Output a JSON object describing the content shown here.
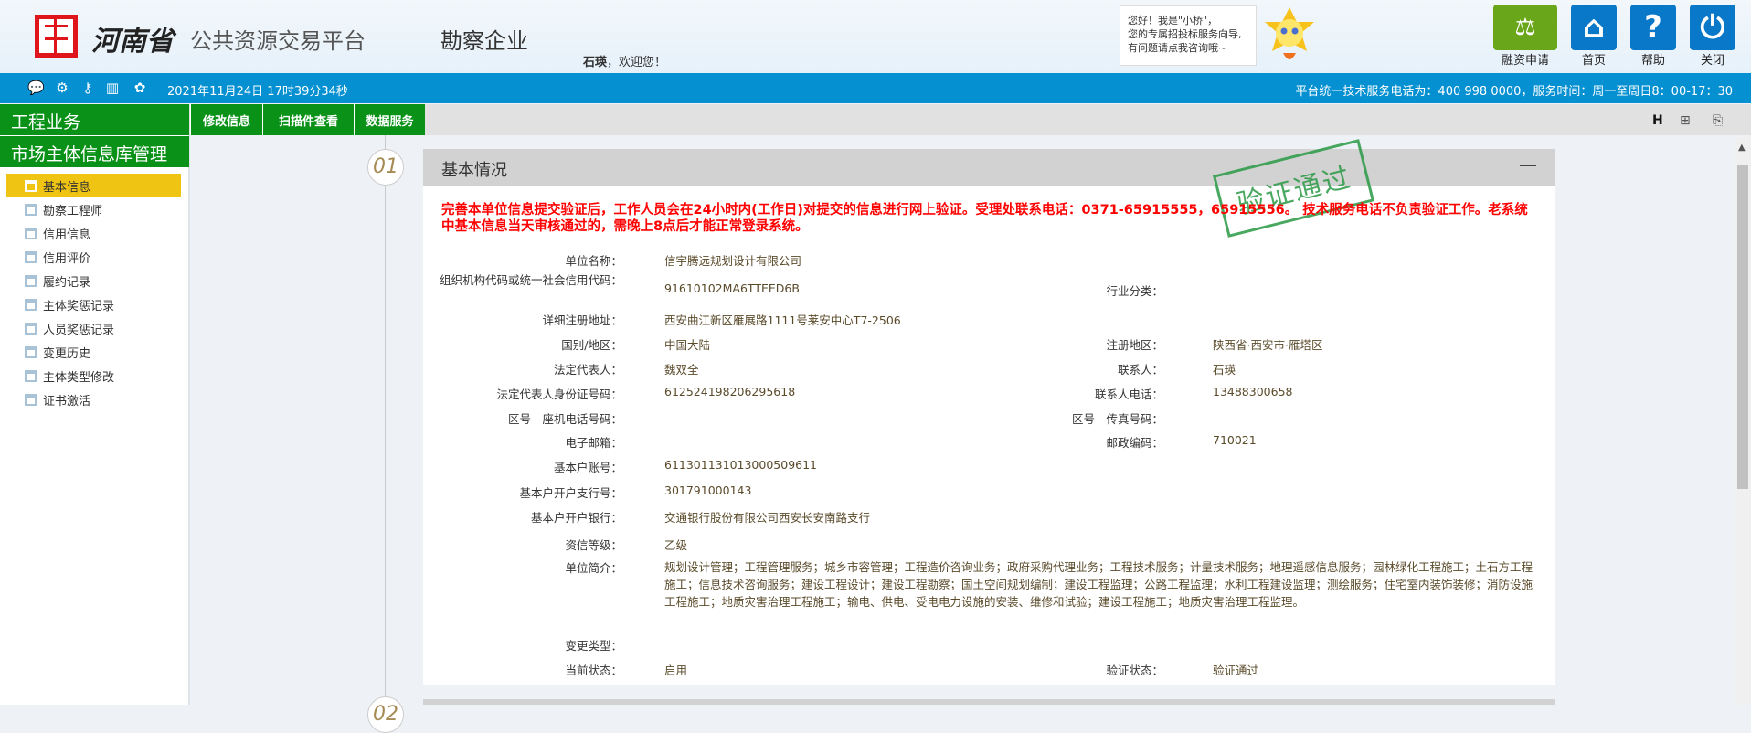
{
  "header": {
    "brand": "河南省",
    "brand_sub": "公共资源交易平台",
    "role": "勘察企业",
    "user": "石瑛",
    "welcome": "，欢迎您！",
    "assistant_lines": [
      "您好！我是\"小桥\"，",
      "您的专属招投标服务向导,",
      "有问题请点我咨询哦~"
    ],
    "buttons": [
      {
        "label": "融资申请",
        "icon": "financing-icon",
        "color": "#6aa61a"
      },
      {
        "label": "首页",
        "icon": "home-icon",
        "color": "#0a78c8"
      },
      {
        "label": "帮助",
        "icon": "help-icon",
        "color": "#0a78c8"
      },
      {
        "label": "关闭",
        "icon": "power-icon",
        "color": "#0a78c8"
      }
    ]
  },
  "bluebar": {
    "datetime": "2021年11月24日 17时39分34秒",
    "service": "平台统一技术服务电话为：400 998 0000，服务时间：周一至周日8：00-17：30",
    "icons": [
      "message-icon",
      "gear-icon",
      "key-icon",
      "gift-icon",
      "globe-icon"
    ]
  },
  "nav": {
    "title": "工程业务",
    "tabs": [
      "修改信息",
      "扫描件查看",
      "数据服务"
    ],
    "tools": [
      "history-icon",
      "org-chart-icon",
      "pdf-icon"
    ]
  },
  "sidebar": {
    "title": "市场主体信息库管理",
    "active": 0,
    "items": [
      "基本信息",
      "勘察工程师",
      "信用信息",
      "信用评价",
      "履约记录",
      "主体奖惩记录",
      "人员奖惩记录",
      "变更历史",
      "主体类型修改",
      "证书激活"
    ]
  },
  "panel": {
    "step": "01",
    "next_step": "02",
    "title": "基本情况",
    "stamp": "验证通过",
    "notice": "完善本单位信息提交验证后，工作人员会在24小时内(工作日)对提交的信息进行网上验证。受理处联系电话：0371-65915555，65915556。 技术服务电话不负责验证工作。老系统中基本信息当天审核通过的，需晚上8点后才能正常登录系统。",
    "fields": [
      {
        "label": "单位名称：",
        "value": "信宇腾远规划设计有限公司"
      },
      {
        "label": "组织机构代码或统一社会信用代码：",
        "value": "91610102MA6TTEED6B",
        "rlabel": "行业分类：",
        "rvalue": ""
      },
      {
        "label": "详细注册地址：",
        "value": "西安曲江新区雁展路1111号莱安中心T7-2506"
      },
      {
        "label": "国别/地区：",
        "value": "中国大陆",
        "rlabel": "注册地区：",
        "rvalue": "陕西省·西安市·雁塔区"
      },
      {
        "label": "法定代表人：",
        "value": "魏双全",
        "rlabel": "联系人：",
        "rvalue": "石瑛"
      },
      {
        "label": "法定代表人身份证号码：",
        "value": "612524198206295618",
        "rlabel": "联系人电话：",
        "rvalue": "13488300658"
      },
      {
        "label": "区号—座机电话号码：",
        "value": "",
        "rlabel": "区号—传真号码：",
        "rvalue": ""
      },
      {
        "label": "电子邮箱：",
        "value": "",
        "rlabel": "邮政编码：",
        "rvalue": "710021"
      },
      {
        "label": "基本户账号：",
        "value": "611301131013000509611"
      },
      {
        "label": "基本户开户支行号：",
        "value": "301791000143"
      },
      {
        "label": "基本户开户银行：",
        "value": "交通银行股份有限公司西安长安南路支行"
      },
      {
        "label": "资信等级：",
        "value": "乙级"
      },
      {
        "label": "单位简介：",
        "value": "规划设计管理；工程管理服务；城乡市容管理；工程造价咨询业务；政府采购代理业务；工程技术服务；计量技术服务；地理遥感信息服务；园林绿化工程施工；土石方工程施工；信息技术咨询服务；建设工程设计；建设工程勘察；国土空间规划编制；建设工程监理；公路工程监理；水利工程建设监理；测绘服务；住宅室内装饰装修；消防设施工程施工；地质灾害治理工程施工；输电、供电、受电电力设施的安装、维修和试验；建设工程施工；地质灾害治理工程监理。"
      },
      {
        "label": "变更类型：",
        "value": ""
      },
      {
        "label": "当前状态：",
        "value": "启用",
        "rlabel": "验证状态：",
        "rvalue": "验证通过"
      }
    ]
  }
}
